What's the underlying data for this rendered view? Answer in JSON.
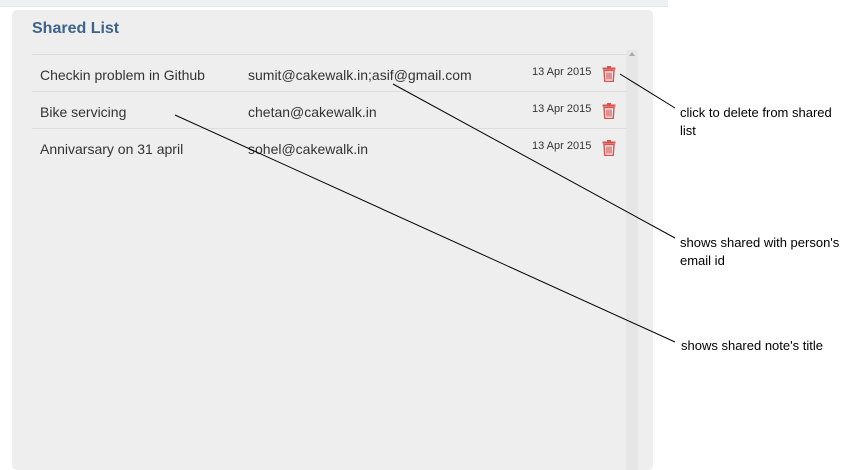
{
  "panel": {
    "title": "Shared List"
  },
  "shared_list": [
    {
      "title": "Checkin problem in Github",
      "email": "sumit@cakewalk.in;asif@gmail.com",
      "date": "13 Apr 2015"
    },
    {
      "title": "Bike servicing",
      "email": "chetan@cakewalk.in",
      "date": "13 Apr 2015"
    },
    {
      "title": "Annivarsary on 31 april",
      "email": "sohel@cakewalk.in",
      "date": "13 Apr 2015"
    }
  ],
  "icons": {
    "delete": "trash-icon",
    "scroll": "scroll-up-arrow-icon"
  },
  "colors": {
    "title": "#3d6488",
    "trash": "#d9534f",
    "panel_bg": "#eeeeee"
  },
  "annotations": {
    "delete": "click to delete from shared list",
    "email": "shows shared with person's email id",
    "title": "shows shared note's title"
  }
}
